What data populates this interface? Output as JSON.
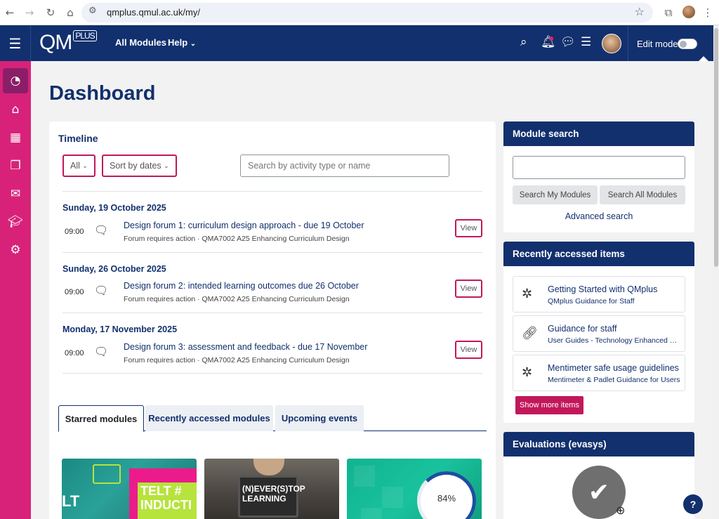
{
  "browser": {
    "url": "qmplus.qmul.ac.uk/my/",
    "icons": [
      "back-icon",
      "forward-icon",
      "reload-icon",
      "home-icon",
      "site-settings-icon",
      "bookmark-star-icon",
      "extensions-icon",
      "profile-avatar",
      "menu-icon"
    ]
  },
  "navbar": {
    "logo_text": "QM",
    "logo_plus": "PLUS",
    "all_modules": "All Modules",
    "help": "Help",
    "edit_mode": "Edit mode",
    "brand_color": "#12306e"
  },
  "rail": {
    "color": "#d8227a",
    "items": [
      "dashboard-icon",
      "home-icon",
      "calendar-icon",
      "content-bank-icon",
      "inbox-icon",
      "graduation-cap-icon",
      "settings-icon"
    ]
  },
  "page": {
    "title": "Dashboard"
  },
  "timeline": {
    "heading": "Timeline",
    "filter_all": "All",
    "sort_label": "Sort by dates",
    "search_placeholder": "Search by activity type or name",
    "groups": [
      {
        "date": "Sunday, 19 October 2025",
        "time": "09:00",
        "title": "Design forum 1: curriculum design approach - due 19 October",
        "subtitle": "Forum requires action · QMA7002 A25 Enhancing Curriculum Design",
        "action": "View"
      },
      {
        "date": "Sunday, 26 October 2025",
        "time": "09:00",
        "title": "Design forum 2: intended learning outcomes due 26 October",
        "subtitle": "Forum requires action · QMA7002 A25 Enhancing Curriculum Design",
        "action": "View"
      },
      {
        "date": "Monday, 17 November 2025",
        "time": "09:00",
        "title": "Design forum 3: assessment and feedback - due 17 November",
        "subtitle": "Forum requires action · QMA7002 A25 Enhancing Curriculum Design",
        "action": "View"
      }
    ]
  },
  "tabs": [
    "Starred modules",
    "Recently accessed modules",
    "Upcoming events"
  ],
  "courses": [
    {
      "image_text": "TELT # INDUCTI",
      "side_text": "LT"
    },
    {
      "image_text": "(N)EVER(S)TOP LEARNING"
    },
    {
      "progress_label": "84%",
      "progress": 0.84
    }
  ],
  "module_search": {
    "heading": "Module search",
    "search_my": "Search My Modules",
    "search_all": "Search All Modules",
    "advanced": "Advanced search"
  },
  "recent_items": {
    "heading": "Recently accessed items",
    "items": [
      {
        "icon": "hub-icon",
        "title": "Getting Started with QMplus",
        "subtitle": "QMplus Guidance for Staff"
      },
      {
        "icon": "link-icon",
        "title": "Guidance for staff",
        "subtitle": "User Guides - Technology Enhanced L…"
      },
      {
        "icon": "hub-icon",
        "title": "Mentimeter safe usage guidelines",
        "subtitle": "Mentimeter & Padlet Guidance for Users"
      }
    ],
    "show_more": "Show more items"
  },
  "evaluations": {
    "heading": "Evaluations (evasys)"
  },
  "help_button": "?"
}
